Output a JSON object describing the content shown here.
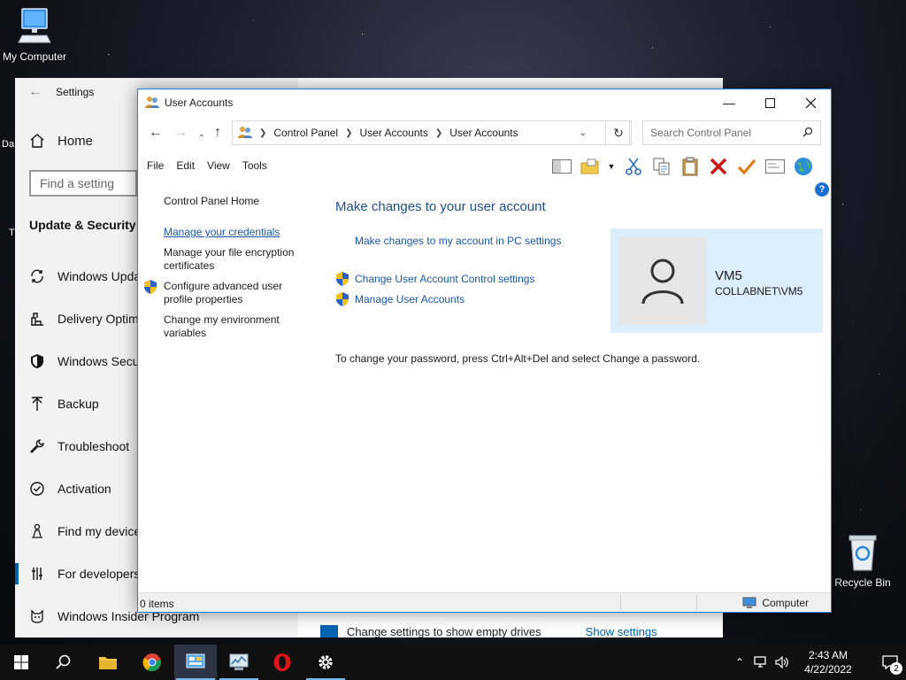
{
  "desktop": {
    "icons": {
      "my_computer": "My Computer",
      "recycle_bin": "Recycle Bin"
    },
    "partial_labels": [
      "Da",
      "T"
    ]
  },
  "settings_window": {
    "title": "Settings",
    "home": "Home",
    "search_placeholder": "Find a setting",
    "section": "Update & Security",
    "nav": [
      {
        "label": "Windows Update",
        "icon": "sync-icon"
      },
      {
        "label": "Delivery Optimization",
        "icon": "delivery-icon"
      },
      {
        "label": "Windows Security",
        "icon": "shield-icon"
      },
      {
        "label": "Backup",
        "icon": "backup-arrow-icon"
      },
      {
        "label": "Troubleshoot",
        "icon": "wrench-icon"
      },
      {
        "label": "Activation",
        "icon": "check-circle-icon"
      },
      {
        "label": "Find my device",
        "icon": "person-pin-icon"
      },
      {
        "label": "For developers",
        "icon": "developer-icon"
      },
      {
        "label": "Windows Insider Program",
        "icon": "insider-cat-icon"
      }
    ],
    "bottom_text": "Change settings to show empty drives",
    "bottom_link": "Show settings"
  },
  "ua_window": {
    "title": "User Accounts",
    "breadcrumb": [
      "Control Panel",
      "User Accounts",
      "User Accounts"
    ],
    "search_placeholder": "Search Control Panel",
    "menu": [
      "File",
      "Edit",
      "View",
      "Tools"
    ],
    "left_pane": {
      "home": "Control Panel Home",
      "credentials": "Manage your credentials",
      "encryption": "Manage your file encryption certificates",
      "profile": "Configure advanced user profile properties",
      "environment": "Change my environment variables"
    },
    "main": {
      "title": "Make changes to your user account",
      "pc_settings_link": "Make changes to my account in PC settings",
      "uac_link": "Change User Account Control settings",
      "manage_link": "Manage User Accounts",
      "password_note": "To change your password, press Ctrl+Alt+Del and select Change a password."
    },
    "user": {
      "name": "VM5",
      "domain": "COLLABNET\\VM5"
    },
    "status": {
      "items": "0 items",
      "location": "Computer"
    }
  },
  "taskbar": {
    "time": "2:43 AM",
    "date": "4/22/2022",
    "notifications": "2"
  },
  "colors": {
    "accent": "#0063b1",
    "link": "#1a56a7",
    "title_blue": "#1e4e8c",
    "card_bg": "#dceefb"
  }
}
